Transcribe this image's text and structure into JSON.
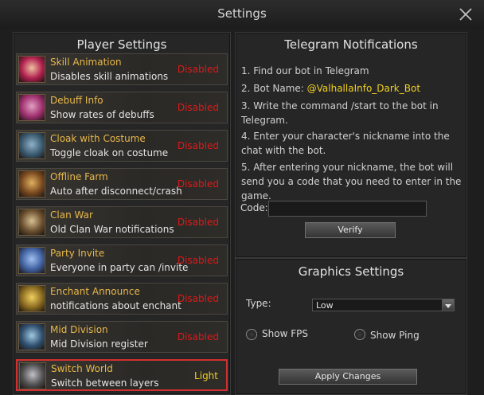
{
  "window": {
    "title": "Settings"
  },
  "player_settings": {
    "title": "Player Settings",
    "items": [
      {
        "name": "Skill Animation",
        "desc": "Disables skill animations",
        "status": "Disabled",
        "icon": "skill-animation-icon"
      },
      {
        "name": "Debuff Info",
        "desc": "Show rates of debuffs",
        "status": "Disabled",
        "icon": "debuff-icon"
      },
      {
        "name": "Cloak with Costume",
        "desc": "Toggle cloak on costume",
        "status": "Disabled",
        "icon": "cloak-icon"
      },
      {
        "name": "Offline Farm",
        "desc": "Auto after disconnect/crash",
        "status": "Disabled",
        "icon": "offline-farm-icon"
      },
      {
        "name": "Clan War",
        "desc": "Old Clan War notifications",
        "status": "Disabled",
        "icon": "clan-war-icon"
      },
      {
        "name": "Party Invite",
        "desc": "Everyone in party can /invite",
        "status": "Disabled",
        "icon": "party-icon"
      },
      {
        "name": "Enchant Announce",
        "desc": "notifications about enchant",
        "status": "Disabled",
        "icon": "enchant-icon"
      },
      {
        "name": "Mid Division",
        "desc": "Mid Division register",
        "status": "Disabled",
        "icon": "mid-division-icon"
      },
      {
        "name": "Switch World",
        "desc": "Switch between layers",
        "status": "Light",
        "icon": "switch-world-icon"
      }
    ]
  },
  "telegram": {
    "title": "Telegram Notifications",
    "step1": "1. Find our bot in Telegram",
    "step2_prefix": "2. Bot Name: ",
    "step2_bot": "@ValhallaInfo_Dark_Bot",
    "step3": "3. Write the command /start to the bot in Telegram.",
    "step4": "4. Enter your character's nickname into the chat with the bot.",
    "step5": "5. After entering your nickname, the bot will send you a code that you need to enter in the game.",
    "code_label": "Code:",
    "code_value": "",
    "verify_label": "Verify"
  },
  "graphics": {
    "title": "Graphics Settings",
    "type_label": "Type:",
    "type_value": "Low",
    "show_fps_label": "Show FPS",
    "show_ping_label": "Show Ping",
    "apply_label": "Apply Changes"
  },
  "colors": {
    "disabled": "#e01818",
    "enabled": "#f0d020",
    "name": "#e8b84a"
  }
}
